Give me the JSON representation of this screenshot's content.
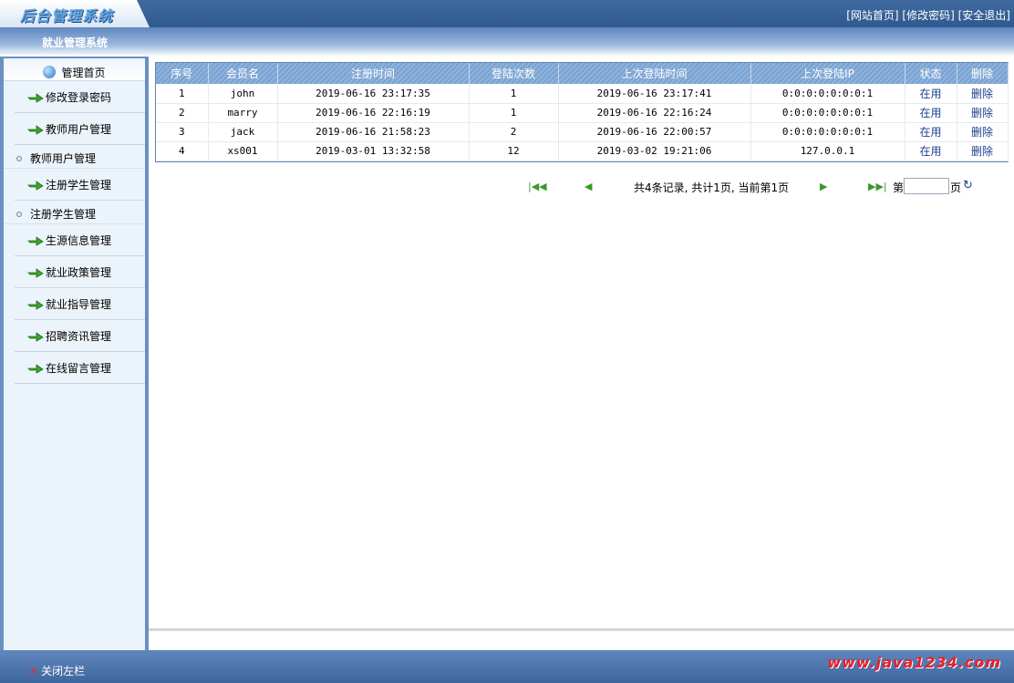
{
  "header": {
    "logo_text": "后台管理系统",
    "links": [
      "[网站首页]",
      "[修改密码]",
      "[安全退出]"
    ]
  },
  "system_title": "就业管理系统",
  "sidebar": {
    "home_label": "管理首页",
    "items": [
      {
        "type": "menu",
        "label": "修改登录密码"
      },
      {
        "type": "menu",
        "label": "教师用户管理"
      },
      {
        "type": "sub",
        "label": "教师用户管理"
      },
      {
        "type": "menu",
        "label": "注册学生管理"
      },
      {
        "type": "sub",
        "label": "注册学生管理"
      },
      {
        "type": "menu",
        "label": "生源信息管理"
      },
      {
        "type": "menu",
        "label": "就业政策管理"
      },
      {
        "type": "menu",
        "label": "就业指导管理"
      },
      {
        "type": "menu",
        "label": "招聘资讯管理"
      },
      {
        "type": "menu",
        "label": "在线留言管理"
      }
    ]
  },
  "table": {
    "columns": [
      "序号",
      "会员名",
      "注册时间",
      "登陆次数",
      "上次登陆时间",
      "上次登陆IP",
      "状态",
      "删除"
    ],
    "rows": [
      [
        "1",
        "john",
        "2019-06-16 23:17:35",
        "1",
        "2019-06-16 23:17:41",
        "0:0:0:0:0:0:0:1",
        "在用",
        "删除"
      ],
      [
        "2",
        "marry",
        "2019-06-16 22:16:19",
        "1",
        "2019-06-16 22:16:24",
        "0:0:0:0:0:0:0:1",
        "在用",
        "删除"
      ],
      [
        "3",
        "jack",
        "2019-06-16 21:58:23",
        "2",
        "2019-06-16 22:00:57",
        "0:0:0:0:0:0:0:1",
        "在用",
        "删除"
      ],
      [
        "4",
        "xs001",
        "2019-03-01 13:32:58",
        "12",
        "2019-03-02 19:21:06",
        "127.0.0.1",
        "在用",
        "删除"
      ]
    ]
  },
  "pager": {
    "info": "共4条记录, 共计1页, 当前第1页",
    "page_prefix": "第",
    "page_suffix": "页",
    "page_value": ""
  },
  "footer": {
    "close_left": "关闭左栏",
    "watermark": "www.java1234.com"
  },
  "colors": {
    "header_bg": "#2f5a8f",
    "accent": "#5b87b8",
    "sidebar_bg": "#ecf4fb",
    "watermark": "#e8202a"
  }
}
